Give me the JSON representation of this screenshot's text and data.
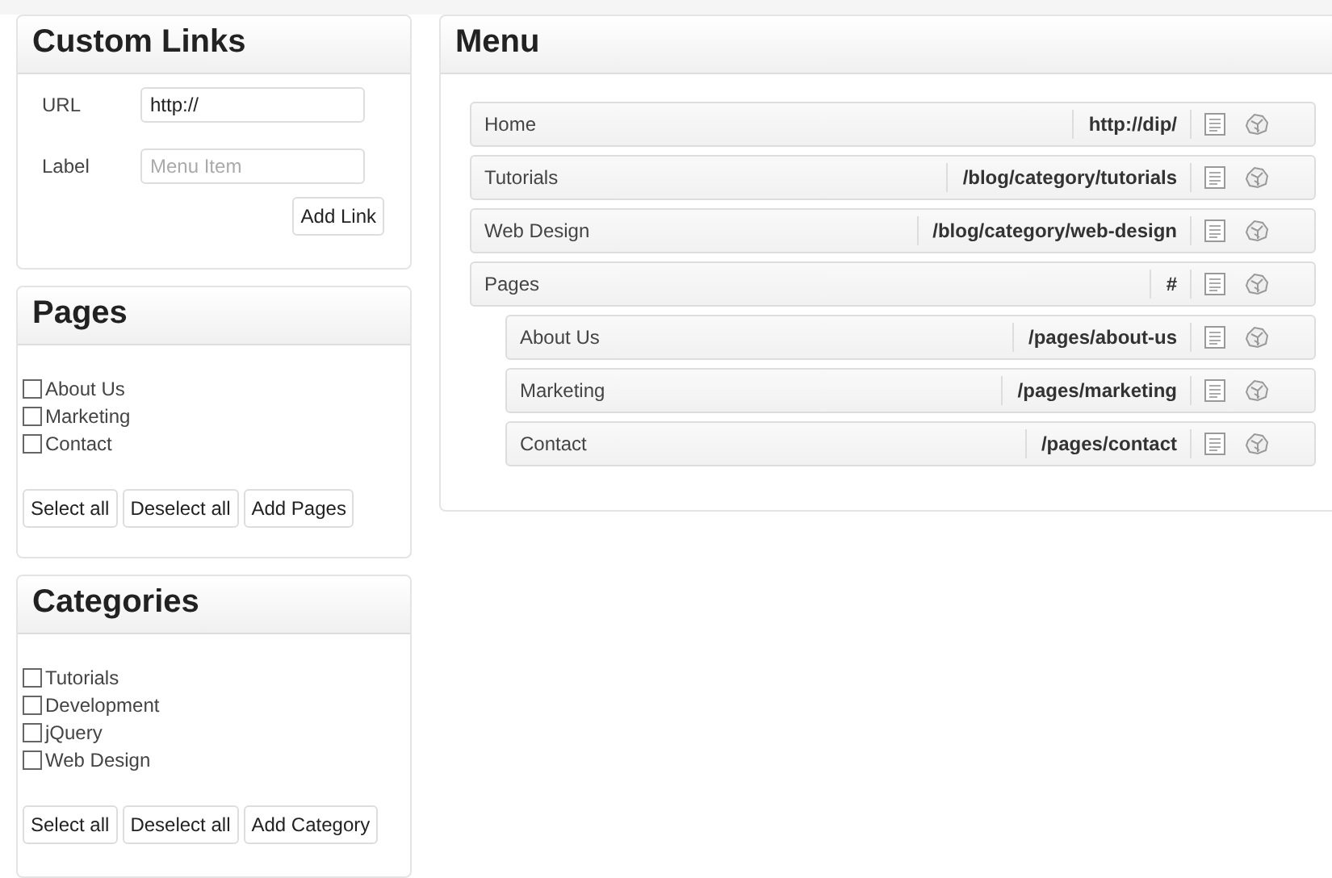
{
  "custom_links": {
    "title": "Custom Links",
    "url": {
      "label": "URL",
      "value": "http://"
    },
    "label_field": {
      "label": "Label",
      "placeholder": "Menu Item"
    },
    "button": "Add Link"
  },
  "pages": {
    "title": "Pages",
    "items": [
      {
        "label": "About Us",
        "checked": false
      },
      {
        "label": "Marketing",
        "checked": false
      },
      {
        "label": "Contact",
        "checked": false
      }
    ],
    "buttons": [
      "Select all",
      "Deselect all",
      "Add Pages"
    ]
  },
  "categories": {
    "title": "Categories",
    "items": [
      {
        "label": "Tutorials",
        "checked": false
      },
      {
        "label": "Development",
        "checked": false
      },
      {
        "label": "jQuery",
        "checked": false
      },
      {
        "label": "Web Design",
        "checked": false
      }
    ],
    "buttons": [
      "Select all",
      "Deselect all",
      "Add Category"
    ]
  },
  "menu": {
    "title": "Menu",
    "items": [
      {
        "label": "Home",
        "url": "http://dip/"
      },
      {
        "label": "Tutorials",
        "url": "/blog/category/tutorials"
      },
      {
        "label": "Web Design",
        "url": "/blog/category/web-design"
      },
      {
        "label": "Pages",
        "url": "#",
        "children": [
          {
            "label": "About Us",
            "url": "/pages/about-us"
          },
          {
            "label": "Marketing",
            "url": "/pages/marketing"
          },
          {
            "label": "Contact",
            "url": "/pages/contact"
          }
        ]
      }
    ]
  }
}
